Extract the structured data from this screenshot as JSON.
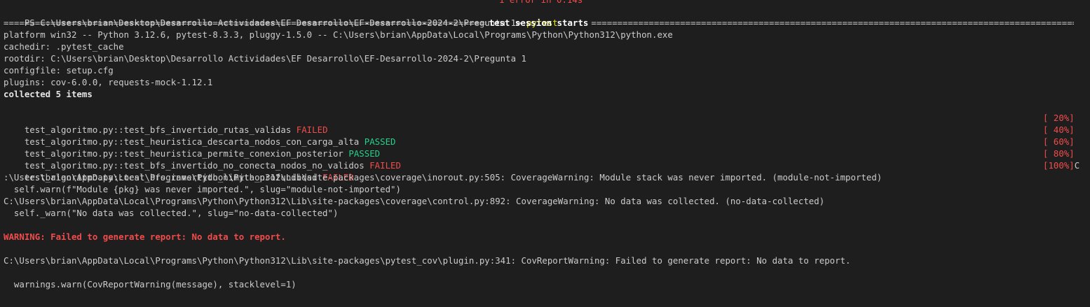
{
  "terminal": {
    "clipped_top": "1 error in 0.14s",
    "prompt": {
      "path": "PS C:\\Users\\brian\\Desktop\\Desarrollo Actividades\\EF Desarrollo\\EF-Desarrollo-2024-2\\Pregunta 1> ",
      "command": "pytest"
    },
    "session_header": "test session starts",
    "info_lines": [
      "platform win32 -- Python 3.12.6, pytest-8.3.3, pluggy-1.5.0 -- C:\\Users\\brian\\AppData\\Local\\Programs\\Python\\Python312\\python.exe",
      "cachedir: .pytest_cache",
      "rootdir: C:\\Users\\brian\\Desktop\\Desarrollo Actividades\\EF Desarrollo\\EF-Desarrollo-2024-2\\Pregunta 1",
      "configfile: setup.cfg",
      "plugins: cov-6.0.0, requests-mock-1.12.1"
    ],
    "collected": "collected 5 items",
    "tests": [
      {
        "name": "test_algoritmo.py::test_bfs_invertido_rutas_validas ",
        "status": "FAILED",
        "progress": "[ 20%]",
        "extra": ""
      },
      {
        "name": "test_algoritmo.py::test_heuristica_descarta_nodos_con_carga_alta ",
        "status": "PASSED",
        "progress": "[ 40%]",
        "extra": ""
      },
      {
        "name": "test_algoritmo.py::test_heuristica_permite_conexion_posterior ",
        "status": "PASSED",
        "progress": "[ 60%]",
        "extra": ""
      },
      {
        "name": "test_algoritmo.py::test_bfs_invertido_no_conecta_nodos_no_validos ",
        "status": "FAILED",
        "progress": "[ 80%]",
        "extra": ""
      },
      {
        "name": "test_algoritmo.py::test_bfs_invertido_limita_profundidad ",
        "status": "FAILED",
        "progress": "[100%]",
        "extra": "C"
      }
    ],
    "coverage_warnings": [
      ":\\Users\\brian\\AppData\\Local\\Programs\\Python\\Python312\\Lib\\site-packages\\coverage\\inorout.py:505: CoverageWarning: Module stack was never imported. (module-not-imported)",
      "  self.warn(f\"Module {pkg} was never imported.\", slug=\"module-not-imported\")",
      "C:\\Users\\brian\\AppData\\Local\\Programs\\Python\\Python312\\Lib\\site-packages\\coverage\\control.py:892: CoverageWarning: No data was collected. (no-data-collected)",
      "  self._warn(\"No data was collected.\", slug=\"no-data-collected\")"
    ],
    "report_warning": "WARNING: Failed to generate report: No data to report.",
    "cov_report_warning": "C:\\Users\\brian\\AppData\\Local\\Programs\\Python\\Python312\\Lib\\site-packages\\pytest_cov\\plugin.py:341: CovReportWarning: Failed to generate report: No data to report.",
    "warnings_call": "  warnings.warn(CovReportWarning(message), stacklevel=1)"
  },
  "colors": {
    "background": "#1e1e1e",
    "foreground": "#cccccc",
    "failed": "#f14c4c",
    "passed": "#23d18b",
    "command": "#e5e510"
  }
}
